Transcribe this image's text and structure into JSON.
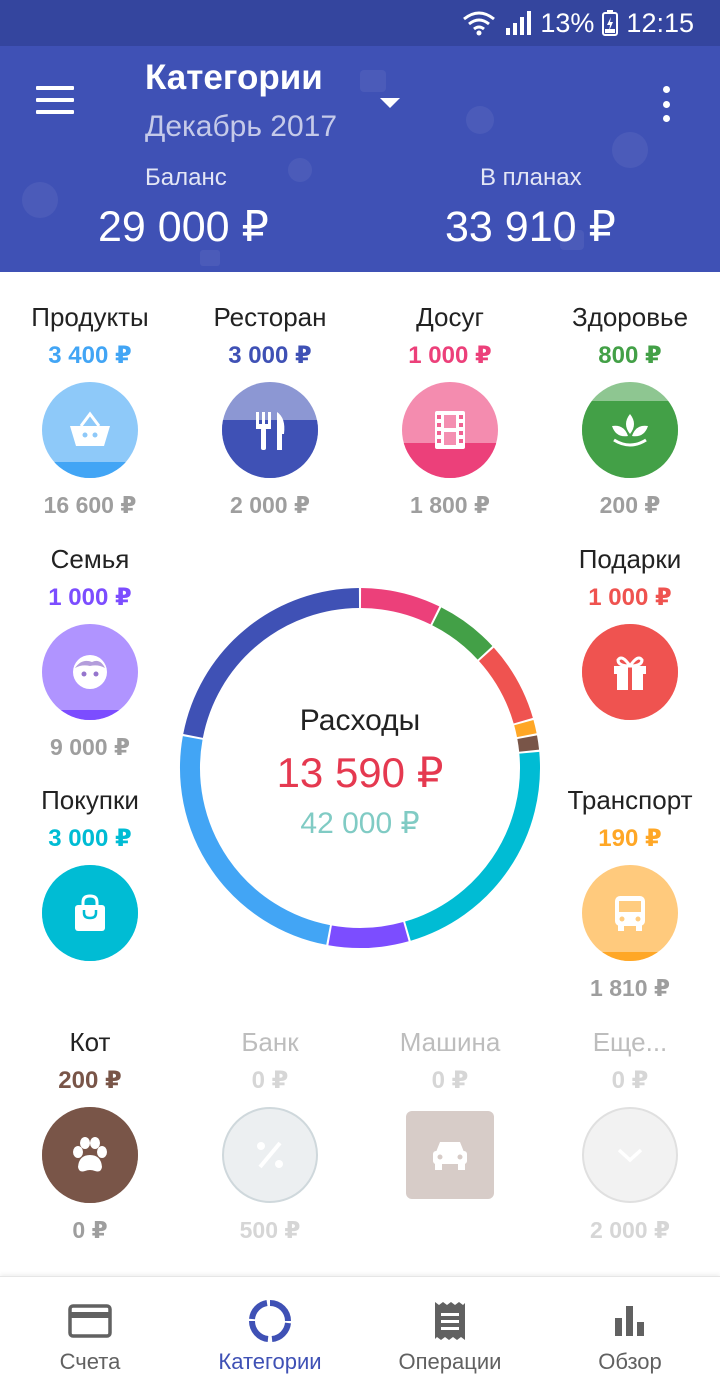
{
  "status_bar": {
    "battery": "13%",
    "time": "12:15"
  },
  "header": {
    "title": "Категории",
    "subtitle": "Декабрь 2017",
    "balance_label": "Баланс",
    "balance_value": "29 000 ₽",
    "planned_label": "В планах",
    "planned_value": "33 910 ₽"
  },
  "categories": [
    {
      "name": "Продукты",
      "amount": "3 400 ₽",
      "plan": "16 600 ₽",
      "color": "#42a5f5",
      "icon": "basket-icon",
      "fill": 0.17
    },
    {
      "name": "Ресторан",
      "amount": "3 000 ₽",
      "plan": "2 000 ₽",
      "color": "#3f51b5",
      "icon": "fork-knife-icon",
      "fill": 0.6
    },
    {
      "name": "Досуг",
      "amount": "1 000 ₽",
      "plan": "1 800 ₽",
      "color": "#ec407a",
      "icon": "film-icon",
      "fill": 0.36
    },
    {
      "name": "Здоровье",
      "amount": "800 ₽",
      "plan": "200 ₽",
      "color": "#43a047",
      "icon": "leaf-icon",
      "fill": 0.8
    },
    {
      "name": "Семья",
      "amount": "1 000 ₽",
      "plan": "9 000 ₽",
      "color": "#7c4dff",
      "icon": "child-face-icon",
      "fill": 0.1
    },
    {
      "name": "Подарки",
      "amount": "1 000 ₽",
      "plan": "",
      "color": "#ef5350",
      "icon": "gift-icon",
      "fill": 1
    },
    {
      "name": "Покупки",
      "amount": "3 000 ₽",
      "plan": "",
      "color": "#00bcd4",
      "icon": "shopping-bag-icon",
      "fill": 1
    },
    {
      "name": "Транспорт",
      "amount": "190 ₽",
      "plan": "1 810 ₽",
      "color": "#ffa726",
      "icon": "bus-icon",
      "fill": 0.09
    },
    {
      "name": "Кот",
      "amount": "200 ₽",
      "plan": "0 ₽",
      "color": "#795548",
      "icon": "paw-icon",
      "fill": 1
    },
    {
      "name": "Банк",
      "amount": "0 ₽",
      "plan": "500 ₽",
      "color": "#cfd8dc",
      "icon": "percent-icon",
      "fill": 0
    },
    {
      "name": "Машина",
      "amount": "0 ₽",
      "plan": "",
      "color": "#d7ccc8",
      "icon": "car-icon",
      "fill": 0
    },
    {
      "name": "Еще...",
      "amount": "0 ₽",
      "plan": "2 000 ₽",
      "color": "#e0e0e0",
      "icon": "chevron-down-icon",
      "fill": 0
    }
  ],
  "summary": {
    "label": "Расходы",
    "spent": "13 590 ₽",
    "planned": "42 000 ₽",
    "spent_color": "#e53950",
    "planned_color": "#80cbc4"
  },
  "chart_data": {
    "type": "pie",
    "style": "donut",
    "series": [
      {
        "name": "Досуг",
        "value": 1000,
        "color": "#ec407a"
      },
      {
        "name": "Здоровье",
        "value": 800,
        "color": "#43a047"
      },
      {
        "name": "Подарки",
        "value": 1000,
        "color": "#ef5350"
      },
      {
        "name": "Транспорт",
        "value": 190,
        "color": "#ffa726"
      },
      {
        "name": "Кот",
        "value": 200,
        "color": "#795548"
      },
      {
        "name": "Покупки",
        "value": 3000,
        "color": "#00bcd4"
      },
      {
        "name": "Семья",
        "value": 1000,
        "color": "#7c4dff"
      },
      {
        "name": "Продукты",
        "value": 3400,
        "color": "#42a5f5"
      },
      {
        "name": "Ресторан",
        "value": 3000,
        "color": "#3f51b5"
      }
    ]
  },
  "nav": [
    {
      "label": "Счета",
      "icon": "card-icon",
      "active": false
    },
    {
      "label": "Категории",
      "icon": "ring-chart-icon",
      "active": true
    },
    {
      "label": "Операции",
      "icon": "receipt-icon",
      "active": false
    },
    {
      "label": "Обзор",
      "icon": "bar-chart-icon",
      "active": false
    }
  ]
}
